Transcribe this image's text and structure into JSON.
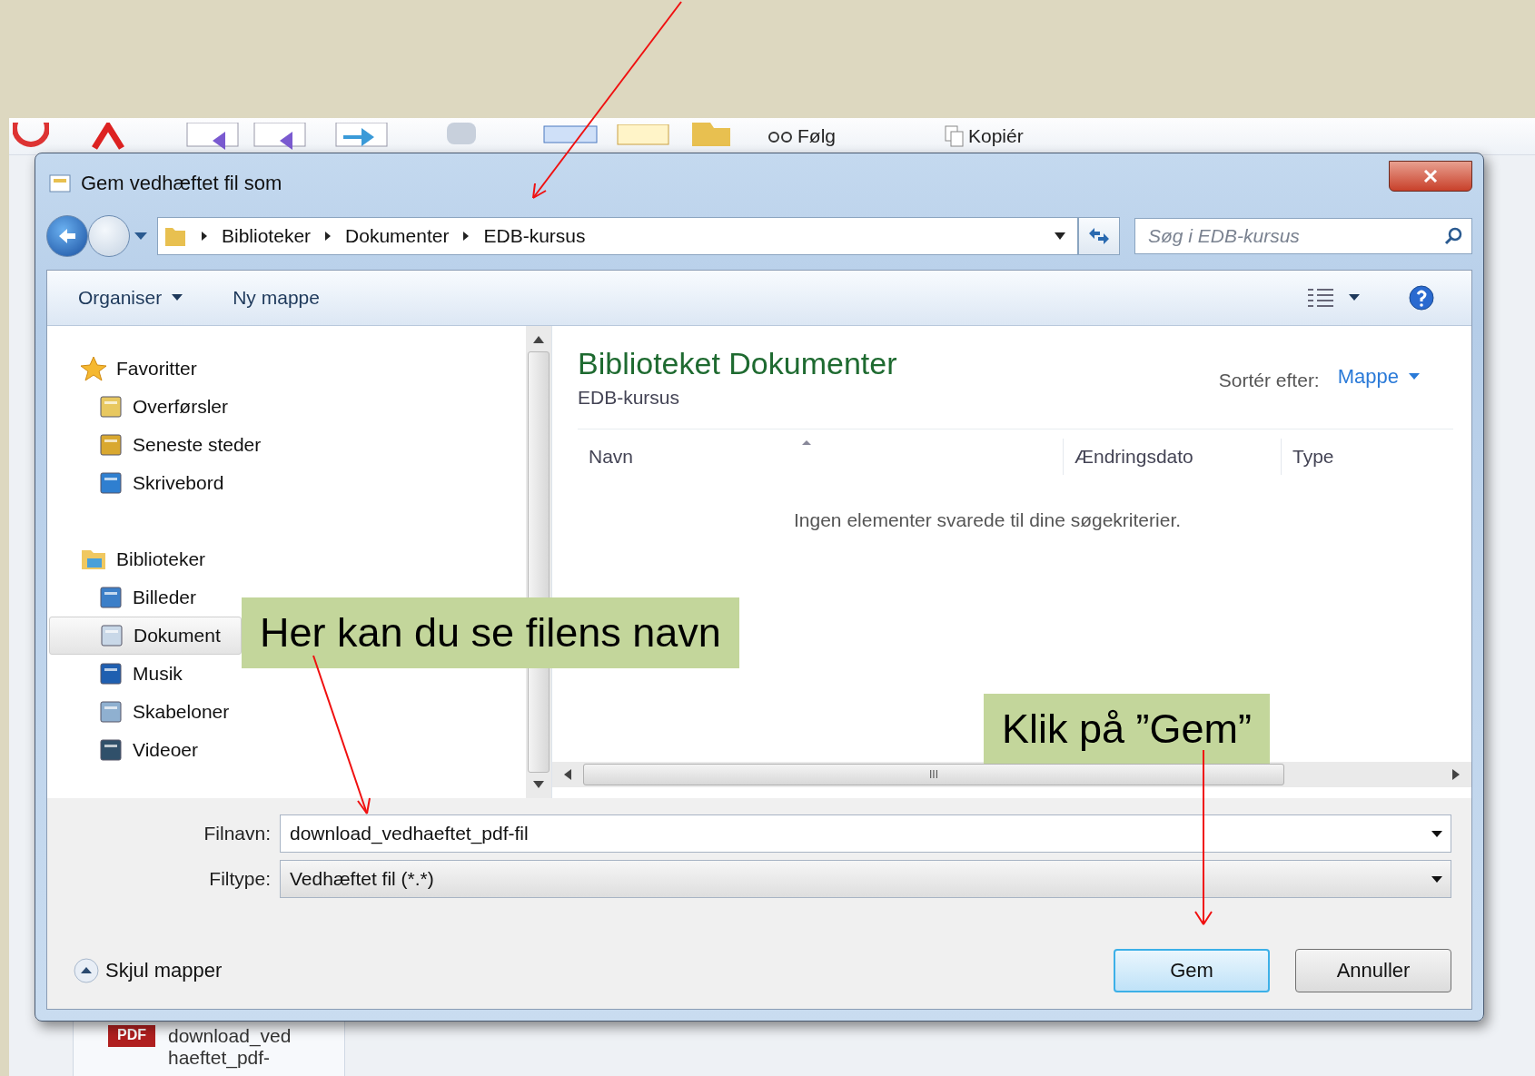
{
  "background_app": {
    "ribbon_buttons": [
      "Følg",
      "Kopiér"
    ],
    "file_item": {
      "badge": "PDF",
      "name_lines": [
        "download_ved",
        "haeftet_pdf-"
      ]
    }
  },
  "dialog": {
    "title": "Gem vedhæftet fil som",
    "breadcrumb": [
      "Biblioteker",
      "Dokumenter",
      "EDB-kursus"
    ],
    "search": {
      "placeholder": "Søg i EDB-kursus"
    },
    "toolbar": [
      {
        "label": "Organiser",
        "dropdown": true
      },
      {
        "label": "Ny mappe",
        "dropdown": false
      }
    ],
    "nav": [
      {
        "label": "Favoritter",
        "selected": false,
        "children": [
          {
            "label": "Overførsler",
            "selected": false
          },
          {
            "label": "Seneste steder",
            "selected": false
          },
          {
            "label": "Skrivebord",
            "selected": false
          }
        ]
      },
      {
        "label": "Biblioteker",
        "selected": false,
        "children": [
          {
            "label": "Billeder",
            "selected": false
          },
          {
            "label": "Dokument",
            "selected": true
          },
          {
            "label": "Musik",
            "selected": false
          },
          {
            "label": "Skabeloner",
            "selected": false
          },
          {
            "label": "Videoer",
            "selected": false
          }
        ]
      }
    ],
    "content": {
      "title": "Biblioteket Dokumenter",
      "subtitle": "EDB-kursus",
      "sort_label": "Sortér efter:",
      "sort_value": "Mappe",
      "columns": [
        "Navn",
        "Ændringsdato",
        "Type"
      ],
      "empty_message": "Ingen elementer svarede til dine søgekriterier.",
      "scroll_grip": "III"
    },
    "fields": [
      {
        "label": "Filnavn:",
        "value": "download_vedhaeftet_pdf-fil",
        "kind": "combo"
      },
      {
        "label": "Filtype:",
        "value": "Vedhæftet fil (*.*)",
        "kind": "select"
      }
    ],
    "hide_folders": "Skjul mapper",
    "buttons": [
      {
        "label": "Gem",
        "default": true
      },
      {
        "label": "Annuller",
        "default": false
      }
    ]
  },
  "annotations": [
    {
      "text": "Her kan du se filens navn"
    },
    {
      "text": "Klik på ”Gem”"
    }
  ]
}
